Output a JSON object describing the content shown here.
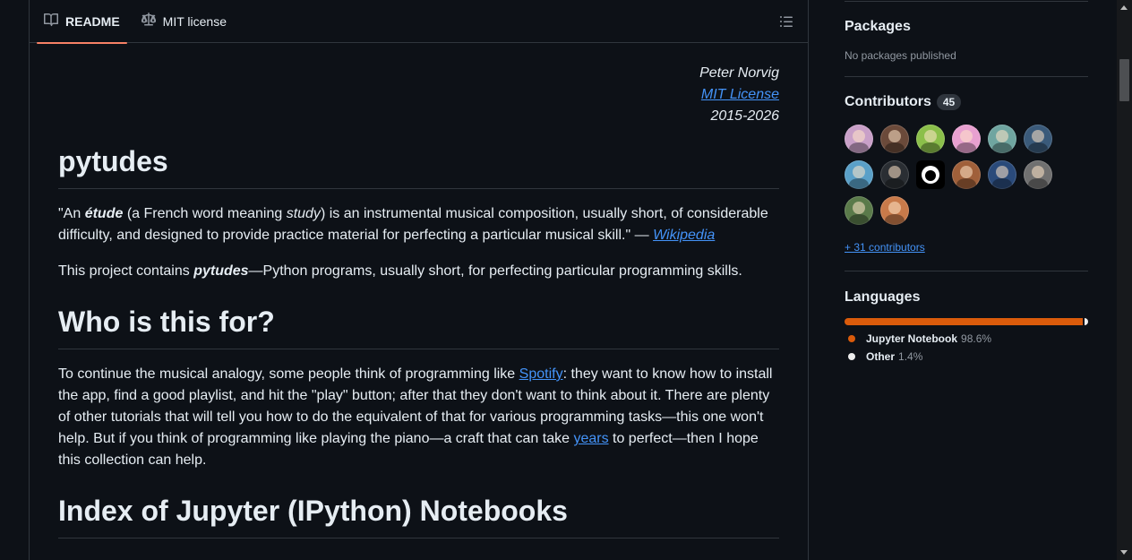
{
  "tabs": [
    {
      "label": "README",
      "icon": "book-icon",
      "active": true
    },
    {
      "label": "MIT license",
      "icon": "scale-icon",
      "active": false
    }
  ],
  "readme": {
    "attribution": {
      "author": "Peter Norvig",
      "license": "MIT License",
      "years": "2015-2026"
    },
    "title": "pytudes",
    "quote": {
      "open": "\"An ",
      "etude": "étude",
      "mid1": " (a French word meaning ",
      "study": "study",
      "mid2": ") is an instrumental musical composition, usually short, of considerable difficulty, and designed to provide practice material for perfecting a particular musical skill.\" — ",
      "link": "Wikipedia"
    },
    "project": {
      "before": "This project contains ",
      "bold": "pytudes",
      "after": "—Python programs, usually short, for perfecting particular programming skills."
    },
    "section1": "Who is this for?",
    "para": {
      "p1": "To continue the musical analogy, some people think of programming like ",
      "spotify": "Spotify",
      "p2": ": they want to know how to install the app, find a good playlist, and hit the \"play\" button; after that they don't want to think about it. There are plenty of other tutorials that will tell you how to do the equivalent of that for various programming tasks—this one won't help. But if you think of programming like playing the piano—a craft that can take ",
      "years": "years",
      "p3": " to perfect—then I hope this collection can help."
    },
    "section2": "Index of Jupyter (IPython) Notebooks"
  },
  "sidebar": {
    "packages": {
      "title": "Packages",
      "text": "No packages published"
    },
    "contributors": {
      "title": "Contributors",
      "count": "45",
      "more": "+ 31 contributors",
      "avatar_colors": [
        "#c9a0c8",
        "#6b4a3a",
        "#8bbf4a",
        "#e8a0d0",
        "#6fa5a0",
        "#3a5a7a",
        "#5aa0c8",
        "#2a2e33",
        "#ffffff",
        "#a0603a",
        "#2a4a7a",
        "#707070",
        "#5a7a4a",
        "#c87a4a"
      ]
    },
    "languages": {
      "title": "Languages",
      "items": [
        {
          "name": "Jupyter Notebook",
          "percent": "98.6%",
          "value": 98.6,
          "color": "#DA5B0B"
        },
        {
          "name": "Other",
          "percent": "1.4%",
          "value": 1.4,
          "color": "#ededed"
        }
      ]
    }
  }
}
